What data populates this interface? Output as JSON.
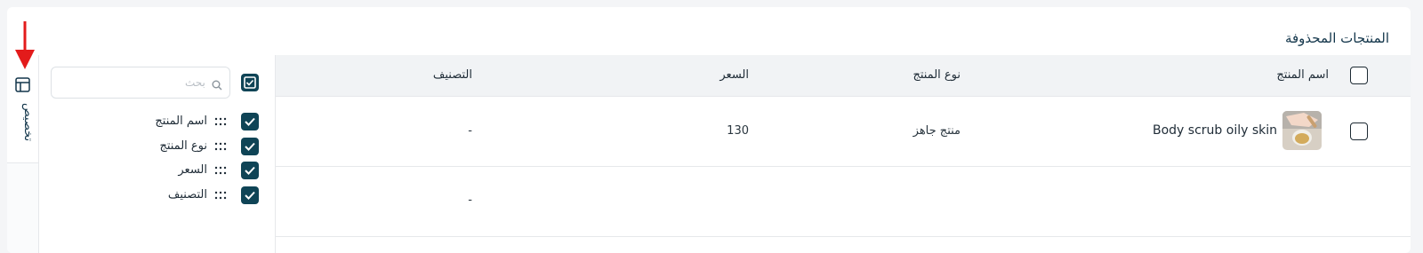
{
  "page": {
    "title": "المنتجات المحذوفة"
  },
  "sidebar": {
    "customize_label": "تخصيص",
    "table_icon": "table-icon",
    "arrow_icon": "arrow-down-icon",
    "arrow_color": "#e31b1b"
  },
  "column_picker": {
    "search_placeholder": "بحث",
    "search_icon": "search-icon",
    "select_all": true,
    "options": [
      {
        "label": "اسم المنتج",
        "checked": true
      },
      {
        "label": "نوع المنتج",
        "checked": true
      },
      {
        "label": "السعر",
        "checked": true
      },
      {
        "label": "التصنيف",
        "checked": true
      }
    ]
  },
  "table": {
    "headers": {
      "name": "اسم المنتج",
      "type": "نوع المنتج",
      "price": "السعر",
      "category": "التصنيف"
    },
    "rows": [
      {
        "name": "Body scrub oily skin",
        "type": "منتج جاهز",
        "price": "130",
        "category": "-"
      },
      {
        "name": "",
        "type": "",
        "price": "",
        "category": "-"
      }
    ]
  },
  "colors": {
    "accent": "#0f4456",
    "header_bg": "#f1f3f5",
    "text": "#12354a"
  }
}
